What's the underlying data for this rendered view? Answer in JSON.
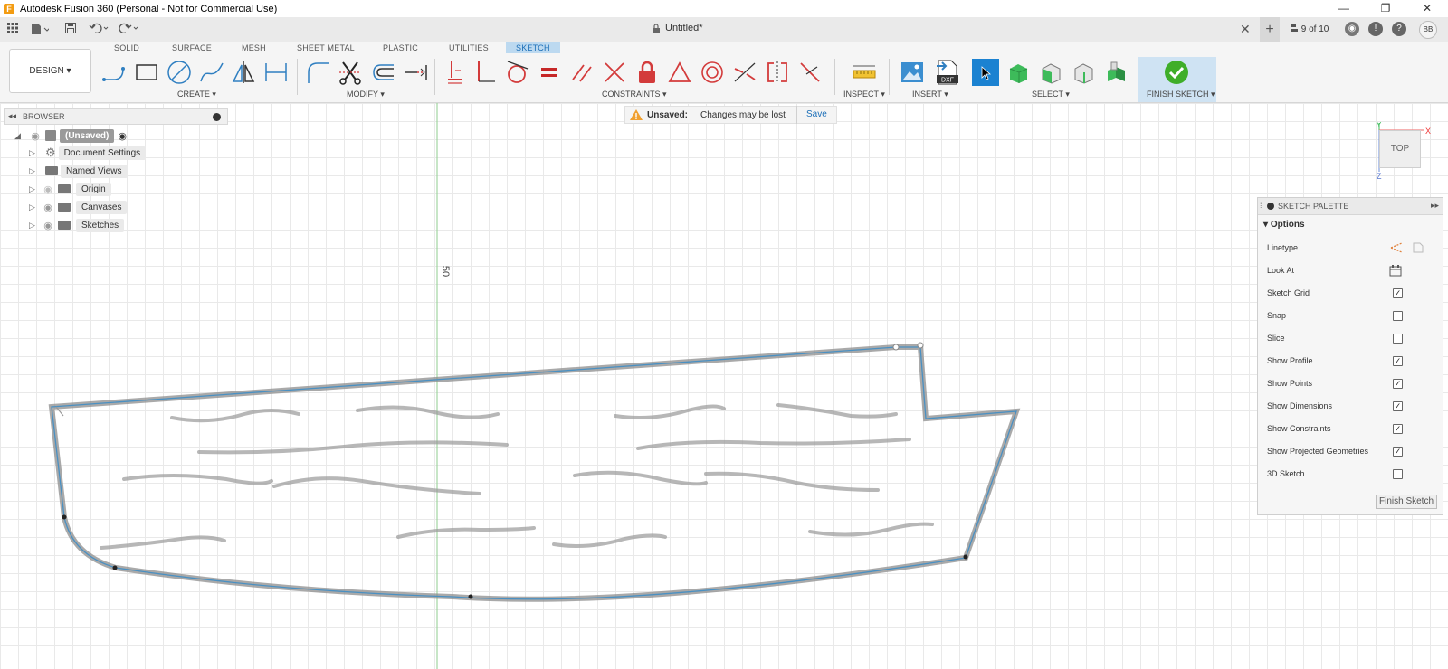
{
  "window": {
    "title": "Autodesk Fusion 360 (Personal - Not for Commercial Use)",
    "controls": [
      "—",
      "❐",
      "✕"
    ]
  },
  "qa": {
    "document_title": "Untitled*",
    "job_status": "9 of 10",
    "avatar": "BB"
  },
  "ribbon": {
    "workspace": "DESIGN",
    "tabs": [
      "SOLID",
      "SURFACE",
      "MESH",
      "SHEET METAL",
      "PLASTIC",
      "UTILITIES",
      "SKETCH"
    ],
    "active_tab": "SKETCH",
    "groups": {
      "create": "CREATE",
      "modify": "MODIFY",
      "constraints": "CONSTRAINTS",
      "inspect": "INSPECT",
      "insert": "INSERT",
      "select": "SELECT",
      "finish": "FINISH SKETCH"
    }
  },
  "browser": {
    "title": "BROWSER",
    "root": "(Unsaved)",
    "items": [
      "Document Settings",
      "Named Views",
      "Origin",
      "Canvases",
      "Sketches"
    ]
  },
  "notice": {
    "label": "Unsaved:",
    "message": "Changes may be lost",
    "action": "Save"
  },
  "canvas": {
    "dimension_label": "50",
    "viewcube_face": "TOP",
    "axes": {
      "x": "X",
      "y": "Y",
      "z": "Z"
    }
  },
  "palette": {
    "title": "SKETCH PALETTE",
    "section": "Options",
    "rows": [
      {
        "label": "Linetype",
        "type": "icon"
      },
      {
        "label": "Look At",
        "type": "icon"
      },
      {
        "label": "Sketch Grid",
        "checked": true
      },
      {
        "label": "Snap",
        "checked": false
      },
      {
        "label": "Slice",
        "checked": false
      },
      {
        "label": "Show Profile",
        "checked": true
      },
      {
        "label": "Show Points",
        "checked": true
      },
      {
        "label": "Show Dimensions",
        "checked": true
      },
      {
        "label": "Show Constraints",
        "checked": true
      },
      {
        "label": "Show Projected Geometries",
        "checked": true
      },
      {
        "label": "3D Sketch",
        "checked": false
      }
    ],
    "finish_label": "Finish Sketch"
  },
  "colors": {
    "accent_blue": "#1c6fb8",
    "constraint_red": "#d33b3b",
    "finish_green": "#3fae29",
    "sketch_line": "#4a90c2"
  }
}
